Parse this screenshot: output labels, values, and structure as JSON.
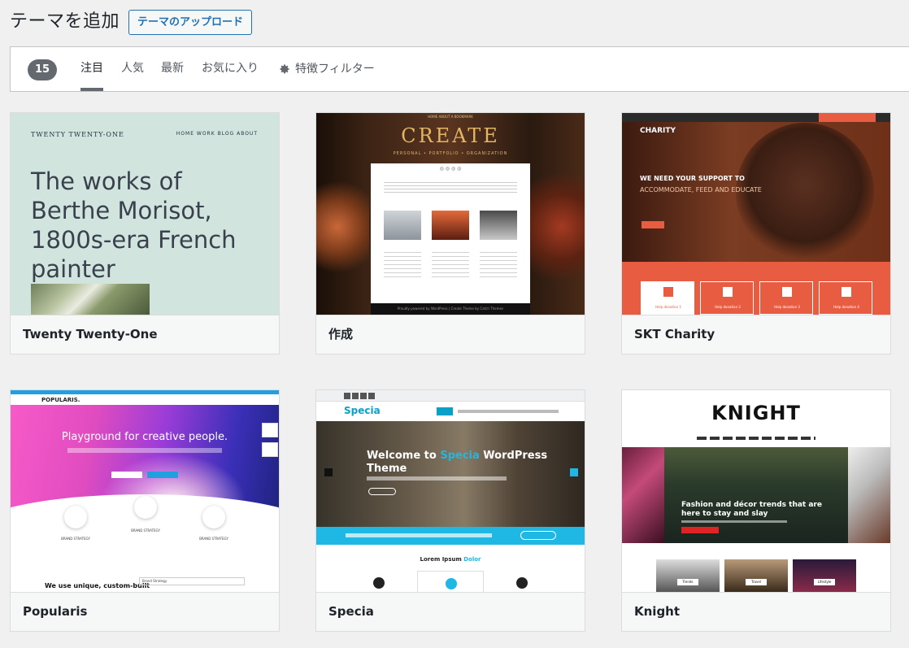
{
  "header": {
    "title": "テーマを追加",
    "upload_label": "テーマのアップロード"
  },
  "filter_bar": {
    "count": "15",
    "tabs": [
      {
        "label": "注目",
        "current": true
      },
      {
        "label": "人気",
        "current": false
      },
      {
        "label": "最新",
        "current": false
      },
      {
        "label": "お気に入り",
        "current": false
      }
    ],
    "feature_filter_label": "特徴フィルター",
    "feature_filter_icon": "gear-icon"
  },
  "themes": [
    {
      "name": "Twenty Twenty-One",
      "preview": {
        "site_title": "TWENTY TWENTY-ONE",
        "menu": "HOME  WORK  BLOG  ABOUT",
        "headline": "The works of Berthe Morisot, 1800s-era French painter"
      }
    },
    {
      "name": "作成",
      "preview": {
        "nav": "HOME   ABOUT   A BOOKMARK",
        "logo": "CREATE",
        "tagline": "PERSONAL • PORTFOLIO • ORGANIZATION",
        "social": "◎ ◎ ◎ ◎",
        "footer": "Proudly powered by WordPress | Create Theme by Catch Themes"
      }
    },
    {
      "name": "SKT Charity",
      "preview": {
        "brand": "CHARITY",
        "headline": "WE NEED YOUR SUPPORT TO",
        "subheadline": "ACCOMMODATE, FEED AND EDUCATE",
        "boxes": [
          "Help donation 1",
          "Help donation 2",
          "Help donation 3",
          "Help donation 4"
        ]
      }
    },
    {
      "name": "Popularis",
      "preview": {
        "brand": "POPULARIS.",
        "headline": "Playground for creative people.",
        "features": [
          "BRAND STRATEGY",
          "BRAND STRATEGY",
          "BRAND STRATEGY"
        ],
        "body": "We use unique, custom-built",
        "select": "Brand Strategy"
      }
    },
    {
      "name": "Specia",
      "preview": {
        "brand": "Specia",
        "headline_a": "Welcome to ",
        "headline_hl": "Specia",
        "headline_b": " WordPress Theme",
        "section_a": "Lorem Ipsum ",
        "section_hl": "Dolor"
      }
    },
    {
      "name": "Knight",
      "preview": {
        "logo": "KNIGHT",
        "headline": "Fashion and décor trends that are here to stay and slay",
        "thumbs": [
          "Trends",
          "Travel",
          "Lifestyle"
        ]
      }
    }
  ]
}
